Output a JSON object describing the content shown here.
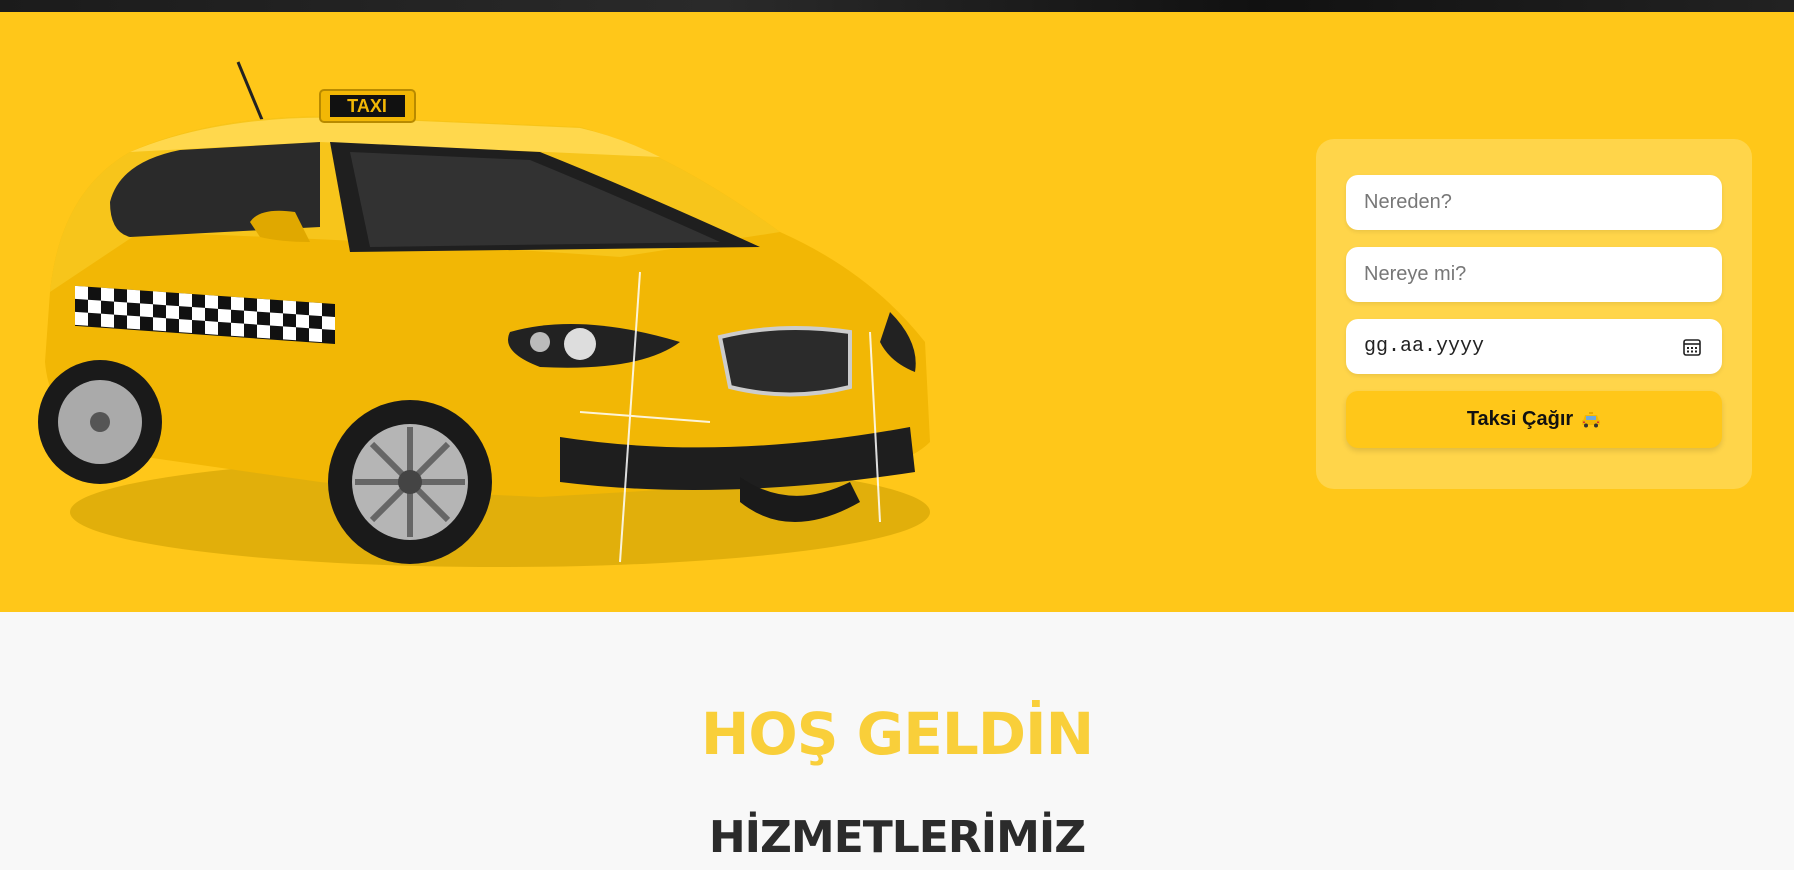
{
  "hero": {
    "taxi_sign": "TAXI",
    "background_color": "#ffc719"
  },
  "booking_form": {
    "from_placeholder": "Nereden?",
    "to_placeholder": "Nereye mi?",
    "date_placeholder": "gg.aa.yyyy",
    "call_button_label": "Taksi Çağır",
    "call_button_icon": "taxi-emoji-icon"
  },
  "sections": {
    "welcome_title": "HOŞ GELDİN",
    "services_title": "HİZMETLERİMİZ"
  },
  "colors": {
    "accent": "#ffc719",
    "welcome_text": "#f9cf3a",
    "heading_text": "#2b2b2b"
  }
}
